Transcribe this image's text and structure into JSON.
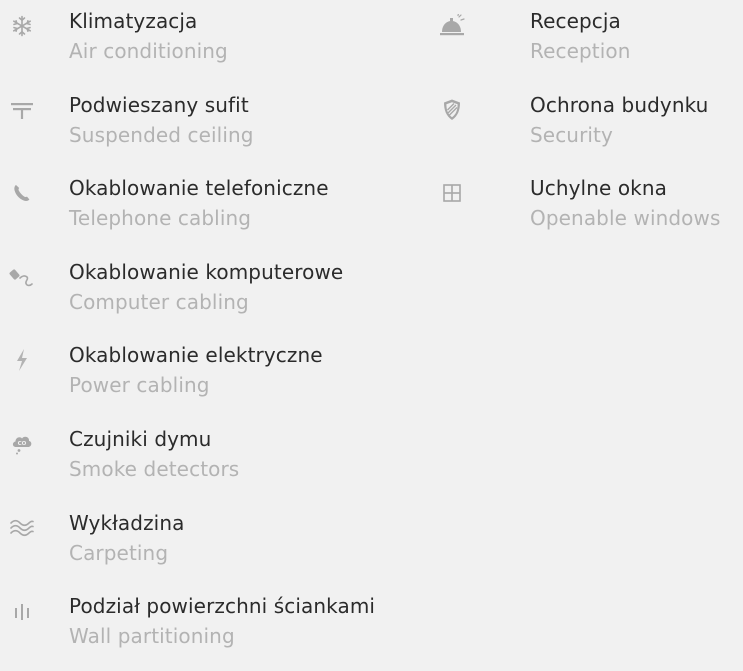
{
  "features_left": [
    {
      "icon": "snowflake-icon",
      "pl": "Klimatyzacja",
      "en": "Air conditioning"
    },
    {
      "icon": "suspended-ceiling-icon",
      "pl": "Podwieszany sufit",
      "en": "Suspended ceiling"
    },
    {
      "icon": "telephone-icon",
      "pl": "Okablowanie telefoniczne",
      "en": "Telephone cabling"
    },
    {
      "icon": "computer-cable-icon",
      "pl": "Okablowanie komputerowe",
      "en": "Computer cabling"
    },
    {
      "icon": "lightning-icon",
      "pl": "Okablowanie elektryczne",
      "en": "Power cabling"
    },
    {
      "icon": "smoke-detector-icon",
      "pl": "Czujniki dymu",
      "en": "Smoke detectors"
    },
    {
      "icon": "carpet-waves-icon",
      "pl": "Wykładzina",
      "en": "Carpeting"
    },
    {
      "icon": "wall-partition-icon",
      "pl": "Podział powierzchni ściankami",
      "en": "Wall partitioning"
    }
  ],
  "features_right": [
    {
      "icon": "reception-bell-icon",
      "pl": "Recepcja",
      "en": "Reception"
    },
    {
      "icon": "security-shield-icon",
      "pl": "Ochrona budynku",
      "en": "Security"
    },
    {
      "icon": "window-icon",
      "pl": "Uchylne okna",
      "en": "Openable windows"
    }
  ],
  "colors": {
    "background": "#f1f1f1",
    "primary_text": "#2b2b2b",
    "secondary_text": "#b3b3b3",
    "icon": "#a8a8a8"
  }
}
